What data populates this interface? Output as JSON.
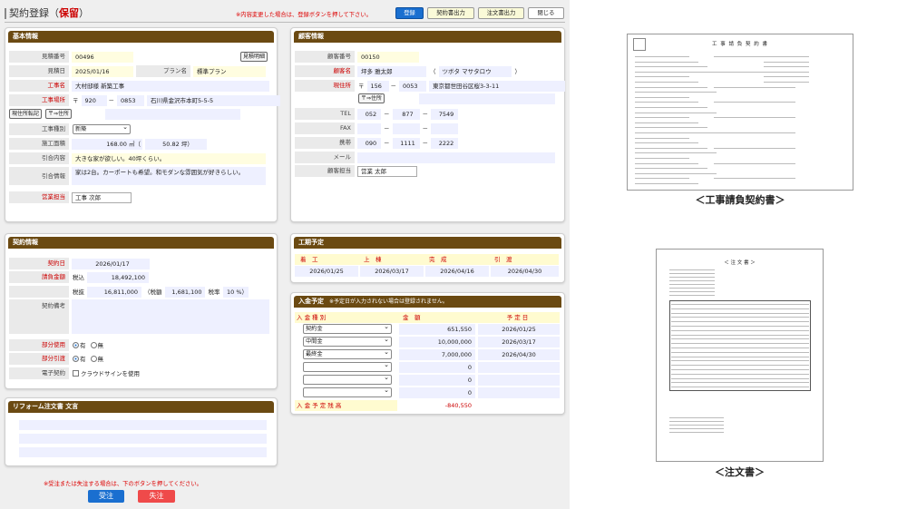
{
  "header": {
    "title": "契約登録",
    "status": "保留",
    "notice": "※内容変更した場合は、登録ボタンを押して下さい。",
    "buttons": {
      "register": "登録",
      "contract_out": "契約書出力",
      "order_out": "注文書出力",
      "close": "閉じる"
    }
  },
  "basic": {
    "title": "基本情報",
    "estimate_no_label": "見積番号",
    "estimate_no": "00496",
    "estimate_detail_button": "見積明細",
    "estimate_date_label": "見積日",
    "estimate_date": "2025/01/16",
    "plan_label": "プラン名",
    "plan": "標準プラン",
    "work_name_label": "工事名",
    "work_name": "大村邸様 新築工事",
    "work_place_label": "工事場所",
    "zip1": "920",
    "zip2": "0853",
    "address": "石川県金沢市本町5-5-5",
    "same_addr_button": "現住所転記",
    "zip_button": "〒⇒住所",
    "work_type_label": "工事種別",
    "work_type": "新築",
    "floor_label": "施工面積",
    "floor_m2": "168.00 ㎡（",
    "floor_tsubo": "50.82 坪）",
    "handover_label": "引合内容",
    "handover": "大きな家が欲しい。40坪くらい。",
    "handover_info_label": "引合情報",
    "handover_info": "家は2台。カーポートも希望。和モダンな雰囲気が好きらしい。",
    "sales_label": "営業担当",
    "sales": "工事 次郎"
  },
  "customer": {
    "title": "顧客情報",
    "no_label": "顧客番号",
    "no": "00150",
    "name_label": "顧客名",
    "name": "坪多 雅太郎",
    "kana": "ツボタ マサタロウ",
    "address_label": "現住所",
    "zip1": "156",
    "zip2": "0053",
    "address": "東京都世田谷区桜3-3-11",
    "zip_button": "〒⇒住所",
    "tel_label": "TEL",
    "tel1": "052",
    "tel2": "877",
    "tel3": "7549",
    "fax_label": "FAX",
    "mobile_label": "携帯",
    "mob1": "090",
    "mob2": "1111",
    "mob3": "2222",
    "mail_label": "メール",
    "staff_label": "顧客担当",
    "staff": "営業 太郎"
  },
  "schedule": {
    "title": "工期予定",
    "cols": [
      "着　工",
      "上　棟",
      "完　成",
      "引　渡"
    ],
    "dates": [
      "2026/01/25",
      "2026/03/17",
      "2026/04/16",
      "2026/04/30"
    ]
  },
  "contract": {
    "title": "契約情報",
    "date_label": "契約日",
    "date": "2026/01/17",
    "amount_label": "請負金額",
    "tax_in_label": "税込",
    "tax_in": "18,492,100",
    "tax_ex_label": "税抜",
    "tax_ex": "16,811,000",
    "tax_label": "（税額",
    "tax": "1,681,100",
    "rate_label": "税率",
    "rate": "10 %）",
    "remarks_label": "契約備考",
    "partial_use_label": "部分使用",
    "partial_hand_label": "部分引渡",
    "yes": "有",
    "no": "無",
    "e_label": "電子契約",
    "cloud_sign": "クラウドサインを使用"
  },
  "payment": {
    "title": "入金予定",
    "note": "※予定日が入力されない場合は登録されません。",
    "headers": [
      "入 金 種 別",
      "金　額",
      "予 定 日"
    ],
    "rows": [
      {
        "type": "契約金",
        "amount": "651,550",
        "date": "2026/01/25"
      },
      {
        "type": "中間金",
        "amount": "10,000,000",
        "date": "2026/03/17"
      },
      {
        "type": "最終金",
        "amount": "7,000,000",
        "date": "2026/04/30"
      },
      {
        "type": "",
        "amount": "0",
        "date": ""
      },
      {
        "type": "",
        "amount": "0",
        "date": ""
      },
      {
        "type": "",
        "amount": "0",
        "date": ""
      }
    ],
    "balance_label": "入 金 予 定 残 高",
    "balance": "-840,550"
  },
  "reform": {
    "title": "リフォーム注文書 文言"
  },
  "footer": {
    "note": "※受注または失注する場合は、下のボタンを押してください。",
    "won": "受注",
    "lost": "失注"
  },
  "previews": {
    "contract_caption": "＜工事請負契約書＞",
    "contract_doc_title": "工 事 請 負 契 約 書",
    "order_caption": "＜注文書＞",
    "order_doc_title": "＜ 注 文 書 ＞"
  },
  "colors": {
    "panel_title": "#6b4a12",
    "accent": "#1a6fd0",
    "required": "#cc0000"
  }
}
